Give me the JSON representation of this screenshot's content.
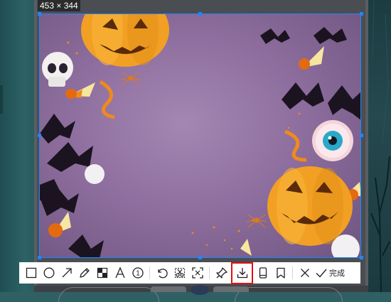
{
  "selection": {
    "size_label": "453 × 344"
  },
  "toolbar": {
    "tools": [
      {
        "name": "rectangle-tool",
        "icon": "rectangle-icon"
      },
      {
        "name": "ellipse-tool",
        "icon": "circle-icon"
      },
      {
        "name": "arrow-tool",
        "icon": "arrow-icon"
      },
      {
        "name": "pen-tool",
        "icon": "pencil-icon"
      },
      {
        "name": "mosaic-tool",
        "icon": "mosaic-icon"
      },
      {
        "name": "text-tool",
        "icon": "text-icon"
      },
      {
        "name": "number-tool",
        "icon": "number-circle-icon",
        "text": "1"
      },
      {
        "name": "undo-button",
        "icon": "undo-icon"
      },
      {
        "name": "scissors-button",
        "icon": "scissors-icon"
      },
      {
        "name": "ocr-button",
        "icon": "ocr-scan-icon"
      },
      {
        "name": "pin-button",
        "icon": "pin-icon"
      },
      {
        "name": "save-button",
        "icon": "download-icon",
        "active": true
      },
      {
        "name": "long-screenshot-button",
        "icon": "phone-icon"
      },
      {
        "name": "bookmark-button",
        "icon": "bookmark-icon"
      },
      {
        "name": "cancel-button",
        "icon": "close-icon"
      },
      {
        "name": "done-button",
        "icon": "check-icon"
      }
    ],
    "done_label": "完成"
  },
  "colors": {
    "selection_border": "#1f86ff",
    "active_highlight": "#e01010",
    "toolbar_bg": "#ffffff"
  }
}
